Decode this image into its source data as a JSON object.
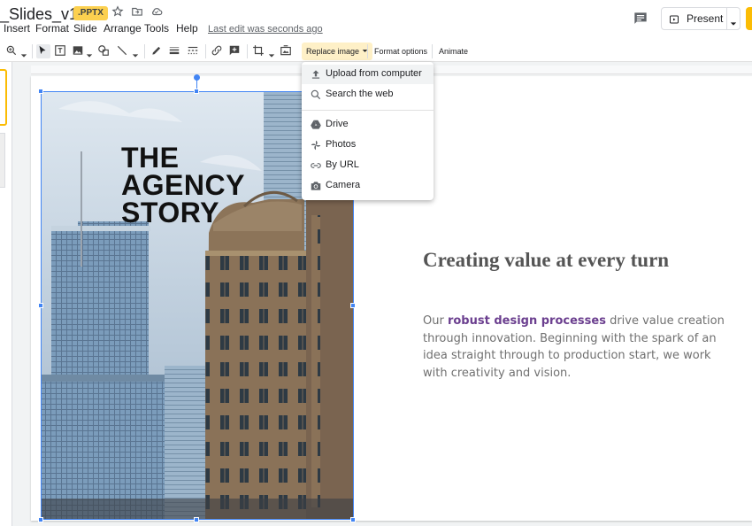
{
  "header": {
    "doc_title": "_Slides_v1.0",
    "file_badge": ".PPTX",
    "last_edit": "Last edit was seconds ago",
    "present_label": "Present"
  },
  "menus": [
    "Insert",
    "Format",
    "Slide",
    "Arrange",
    "Tools",
    "Help"
  ],
  "toolbar": {
    "replace_image": "Replace image",
    "format_options": "Format options",
    "animate": "Animate"
  },
  "dropdown": {
    "items": [
      {
        "label": "Upload from computer",
        "icon": "upload-icon"
      },
      {
        "label": "Search the web",
        "icon": "search-icon"
      },
      {
        "label": "Drive",
        "icon": "drive-icon"
      },
      {
        "label": "Photos",
        "icon": "photos-icon"
      },
      {
        "label": "By URL",
        "icon": "link-icon"
      },
      {
        "label": "Camera",
        "icon": "camera-icon"
      }
    ]
  },
  "slide": {
    "title_lines": [
      "THE",
      "AGENCY",
      "STORY"
    ],
    "heading": "Creating value at every turn",
    "body_prefix": "Our ",
    "body_emphasis": "robust design processes",
    "body_suffix": " drive value creation through innovation. Beginning with the spark of an idea straight through to production start, we work with creativity and vision."
  },
  "colors": {
    "accent": "#fbbc04",
    "selection": "#4285f4",
    "emphasis": "#6b3f8f",
    "badge": "#fcd04f"
  }
}
